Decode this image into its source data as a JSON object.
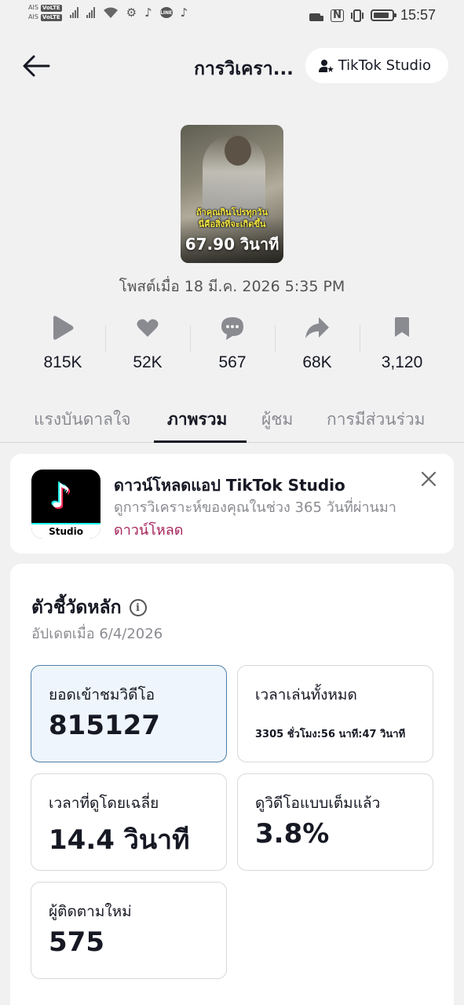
{
  "status_bar": {
    "carrier_1": "AIS",
    "carrier_2": "AIS",
    "volte_1": "VoLTE",
    "volte_2": "VoLTE",
    "line_badge": "LINE",
    "nfc": "N",
    "battery_level": 0.85,
    "time": "15:57"
  },
  "header": {
    "back_icon": "arrow-left-icon",
    "title": "การวิเครา...",
    "studio_button": "TikTok Studio"
  },
  "video": {
    "caption_line1": "ถ้าคุณกินโปรทุกวัน",
    "caption_line2": "นี่คือสิ่งที่จะเกิดขึ้น",
    "duration": "67.90 วินาที",
    "posted": "โพสต์เมื่อ 18 มี.ค. 2026 5:35 PM"
  },
  "stats": [
    {
      "icon": "play-icon",
      "value": "815K"
    },
    {
      "icon": "heart-icon",
      "value": "52K"
    },
    {
      "icon": "comment-icon",
      "value": "567"
    },
    {
      "icon": "share-icon",
      "value": "68K"
    },
    {
      "icon": "bookmark-icon",
      "value": "3,120"
    }
  ],
  "tabs": [
    {
      "label": "แรงบันดาลใจ",
      "active": false
    },
    {
      "label": "ภาพรวม",
      "active": true
    },
    {
      "label": "ผู้ชม",
      "active": false
    },
    {
      "label": "การมีส่วนร่วม",
      "active": false
    }
  ],
  "download_card": {
    "app_icon_label": "Studio",
    "title": "ดาวน์โหลดแอป TikTok Studio",
    "description": "ดูการวิเคราะห์ของคุณในช่วง 365 วันที่ผ่านมา",
    "link": "ดาวน์โหลด"
  },
  "metrics": {
    "title": "ตัวชี้วัดหลัก",
    "info_icon": "i",
    "updated": "อัปเดตเมื่อ 6/4/2026",
    "items": [
      {
        "label": "ยอดเข้าชมวิดีโอ",
        "value": "815127"
      },
      {
        "label": "เวลาเล่นทั้งหมด",
        "value": "3305 ชั่วโมง:56 นาที:47 วินาที"
      },
      {
        "label": "เวลาที่ดูโดยเฉลี่ย",
        "value": "14.4 วินาที"
      },
      {
        "label": "ดูวิดีโอแบบเต็มแล้ว",
        "value": "3.8%"
      },
      {
        "label": "ผู้ติดตามใหม่",
        "value": "575"
      }
    ]
  },
  "colors": {
    "accent_link": "#a5225b",
    "selected_card_bg": "#eef5fc",
    "selected_card_border": "#4f7fa8"
  }
}
